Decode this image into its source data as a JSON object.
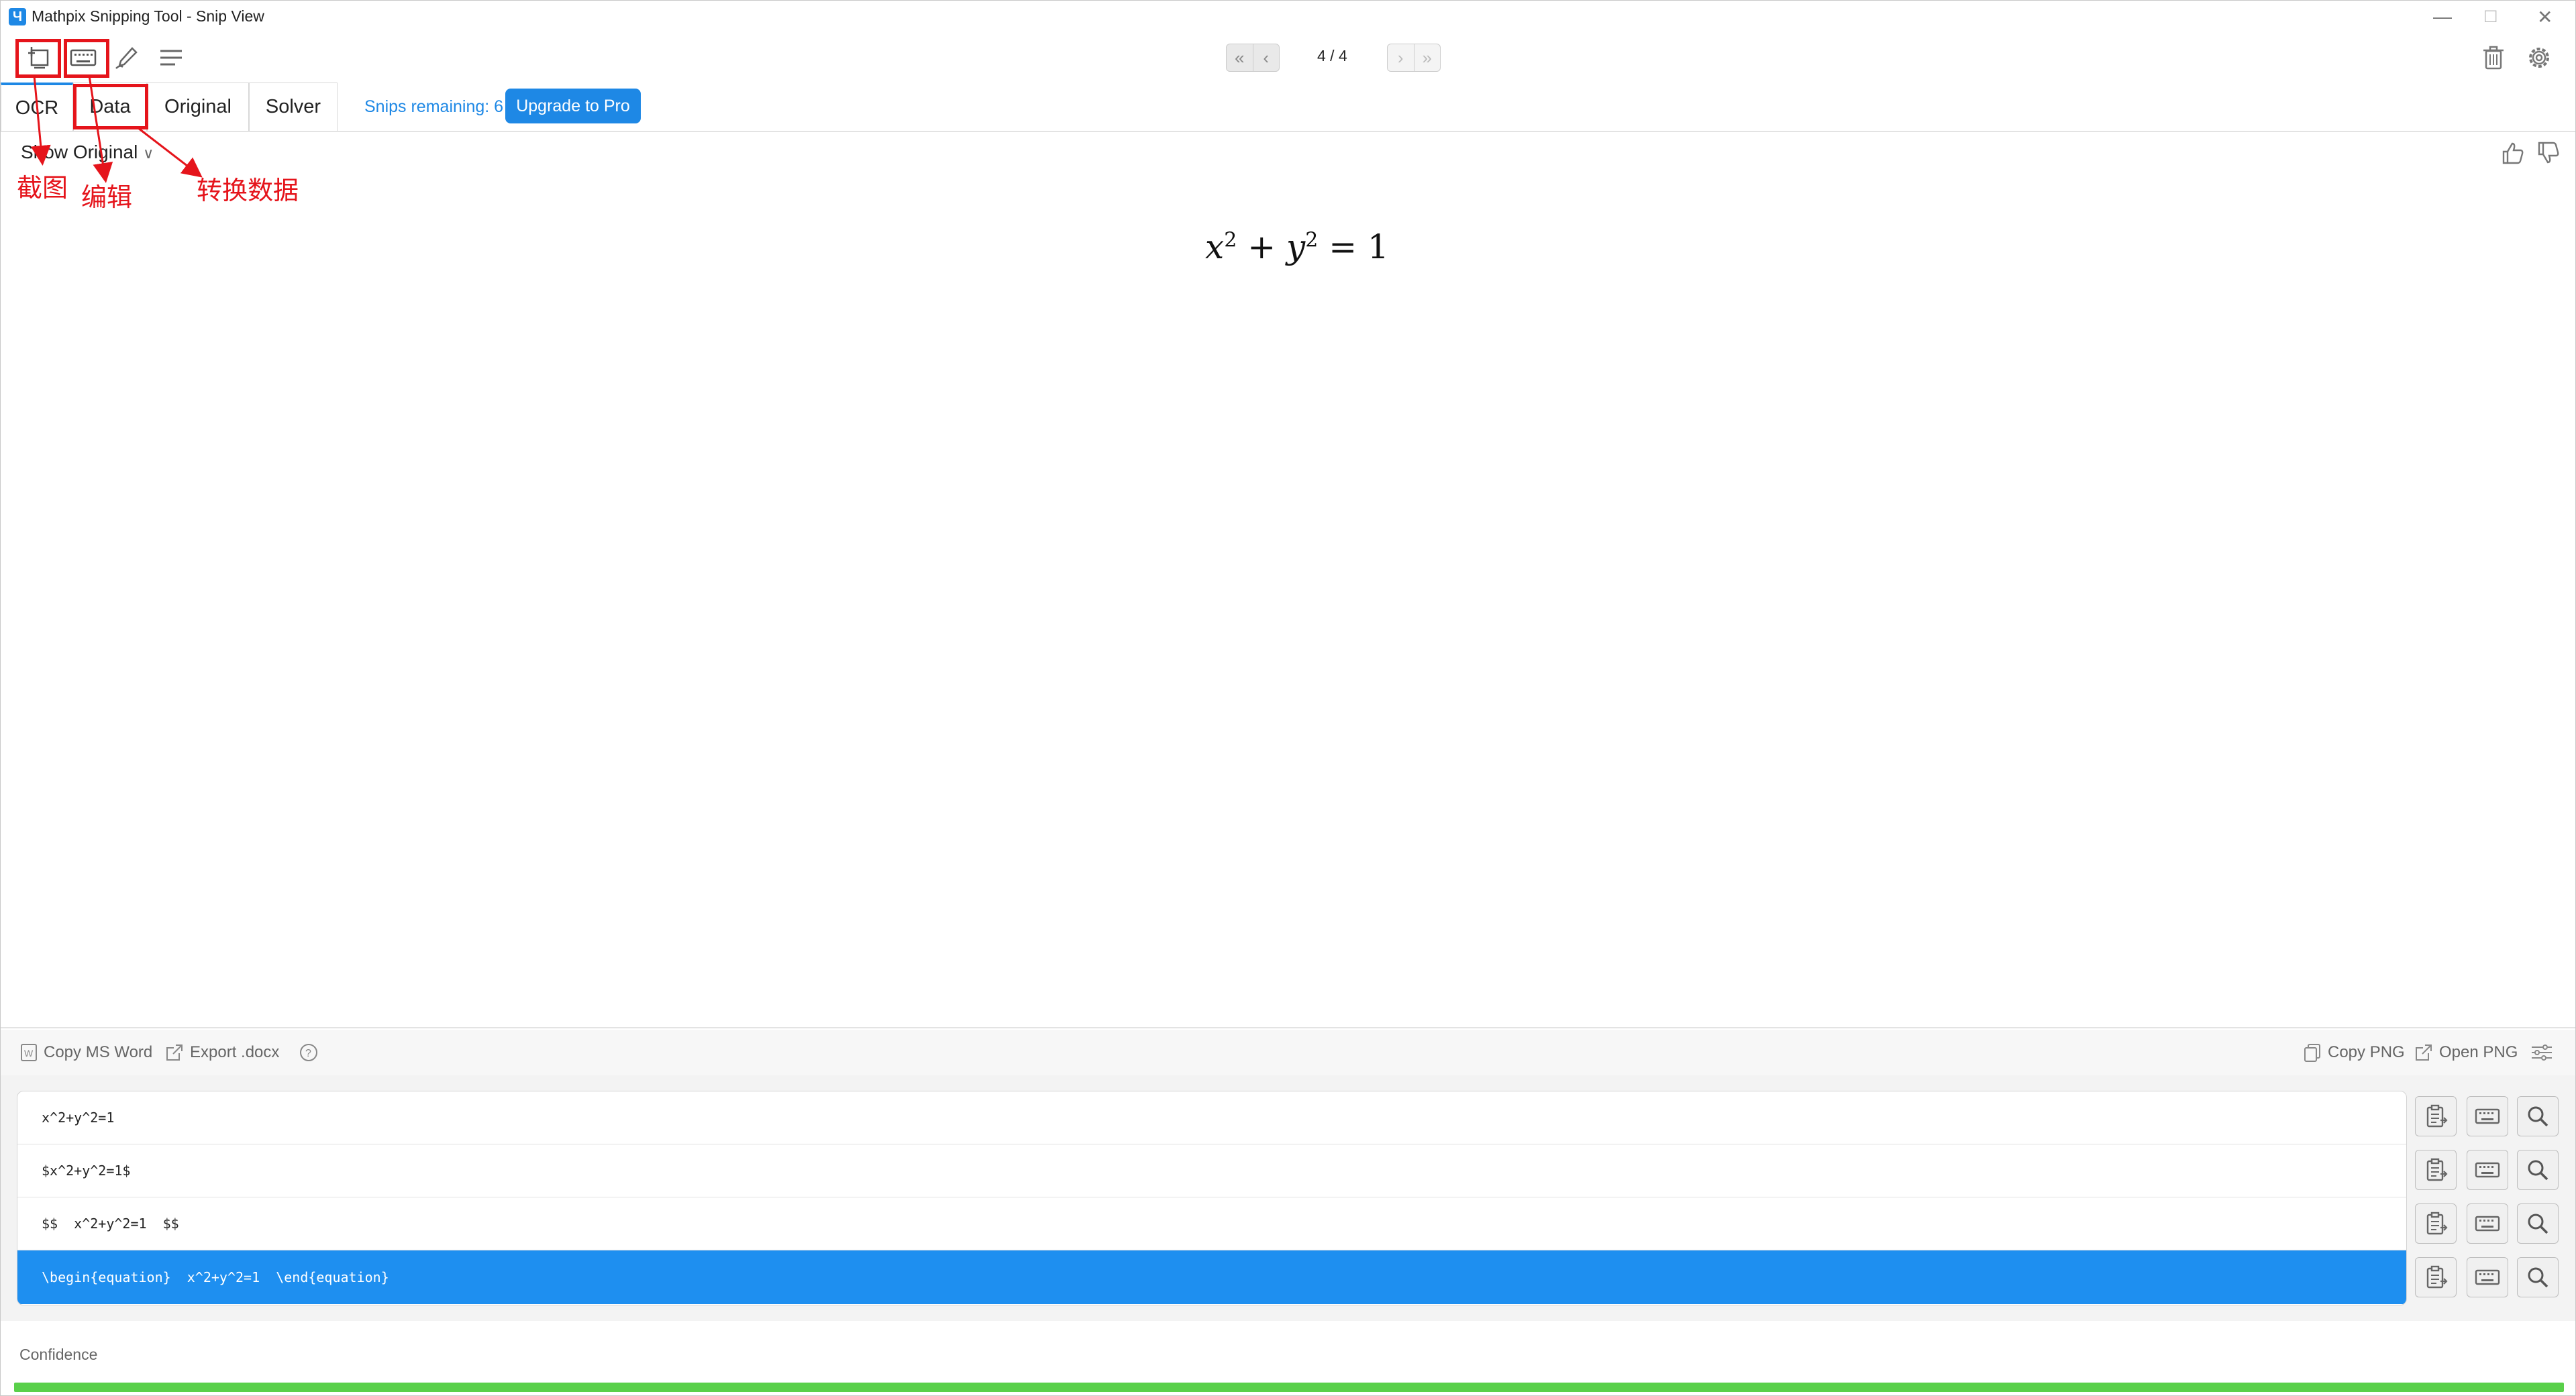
{
  "window": {
    "title": "Mathpix Snipping Tool - Snip View",
    "logo_letter": "Ч",
    "minimize_glyph": "—",
    "maximize_glyph": "☐",
    "close_glyph": "✕"
  },
  "toolbar": {
    "icons": [
      "screenshot-icon",
      "keyboard-icon",
      "pen-icon",
      "menu-icon"
    ],
    "pager": "4 / 4"
  },
  "tabs": [
    "OCR",
    "Data",
    "Original",
    "Solver"
  ],
  "active_tab": "OCR",
  "snips_remaining": "Snips remaining: 6",
  "upgrade_label": "Upgrade to Pro",
  "show_original": "Show Original",
  "formula": {
    "x": "x",
    "y": "y",
    "exp": "2",
    "rhs": "1"
  },
  "annotations": {
    "snip": "截图",
    "edit": "编辑",
    "convert": "转换数据"
  },
  "actions": {
    "copy_word": "Copy MS Word",
    "export_docx": "Export .docx",
    "copy_png": "Copy PNG",
    "open_png": "Open PNG"
  },
  "formats": [
    "x^2+y^2=1",
    "$x^2+y^2=1$",
    "$$  x^2+y^2=1  $$",
    "\\begin{equation}  x^2+y^2=1  \\end{equation}"
  ],
  "selected_format_index": 3,
  "confidence_label": "Confidence",
  "confidence_level": 1.0,
  "colors": {
    "accent": "#1e88e5",
    "annotation": "#e5141b",
    "confidence": "#59d04a"
  }
}
